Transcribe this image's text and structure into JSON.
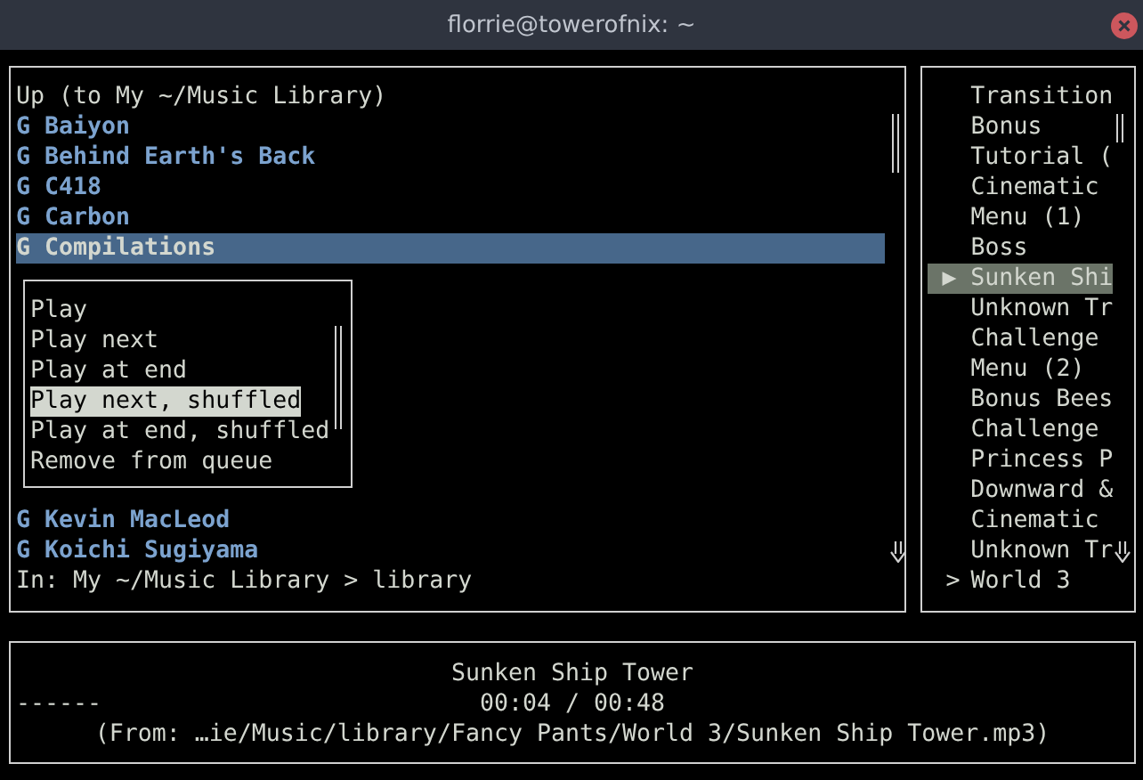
{
  "window": {
    "title": "florrie@towerofnix: ~"
  },
  "browser": {
    "up_label": "Up (to My ~/Music Library)",
    "items": [
      {
        "prefix": "G",
        "name": "Baiyon",
        "selected": false
      },
      {
        "prefix": "G",
        "name": "Behind Earth's Back",
        "selected": false
      },
      {
        "prefix": "G",
        "name": "C418",
        "selected": false
      },
      {
        "prefix": "G",
        "name": "Carbon",
        "selected": false
      },
      {
        "prefix": "G",
        "name": "Compilations",
        "selected": true
      }
    ],
    "items_below": [
      {
        "prefix": "G",
        "name": "Kevin MacLeod",
        "selected": false
      },
      {
        "prefix": "G",
        "name": "Koichi Sugiyama",
        "selected": false
      }
    ],
    "location": "In: My ~/Music Library > library"
  },
  "context_menu": {
    "items": [
      {
        "label": "Play",
        "selected": false
      },
      {
        "label": "Play next",
        "selected": false
      },
      {
        "label": "Play at end",
        "selected": false
      },
      {
        "label": "Play next, shuffled",
        "selected": true
      },
      {
        "label": "Play at end, shuffled",
        "selected": false
      },
      {
        "label": "Remove from queue",
        "selected": false
      }
    ]
  },
  "queue": {
    "items": [
      {
        "kind": "track",
        "label": "Transition",
        "selected": false
      },
      {
        "kind": "track",
        "label": "Bonus",
        "selected": false
      },
      {
        "kind": "track",
        "label": "Tutorial (",
        "selected": false
      },
      {
        "kind": "track",
        "label": "Cinematic",
        "selected": false
      },
      {
        "kind": "track",
        "label": "Menu (1)",
        "selected": false
      },
      {
        "kind": "track",
        "label": "Boss",
        "selected": false
      },
      {
        "kind": "track",
        "marker": "▶",
        "label": "Sunken Shi",
        "selected": true
      },
      {
        "kind": "track",
        "label": "Unknown Tr",
        "selected": false
      },
      {
        "kind": "track",
        "label": "Challenge",
        "selected": false
      },
      {
        "kind": "track",
        "label": "Menu (2)",
        "selected": false
      },
      {
        "kind": "track",
        "label": "Bonus Bees",
        "selected": false
      },
      {
        "kind": "track",
        "label": "Challenge",
        "selected": false
      },
      {
        "kind": "track",
        "label": "Princess P",
        "selected": false
      },
      {
        "kind": "track",
        "label": "Downward &",
        "selected": false
      },
      {
        "kind": "track",
        "label": "Cinematic",
        "selected": false
      },
      {
        "kind": "track",
        "label": "Unknown Tr",
        "selected": false
      },
      {
        "kind": "group",
        "marker": ">",
        "label": "World 3",
        "selected": false
      }
    ]
  },
  "now_playing": {
    "title": "Sunken Ship Tower",
    "progress": "------",
    "time": "00:04 / 00:48",
    "source": "(From: …ie/Music/library/Fancy Pants/World 3/Sunken Ship Tower.mp3)"
  }
}
